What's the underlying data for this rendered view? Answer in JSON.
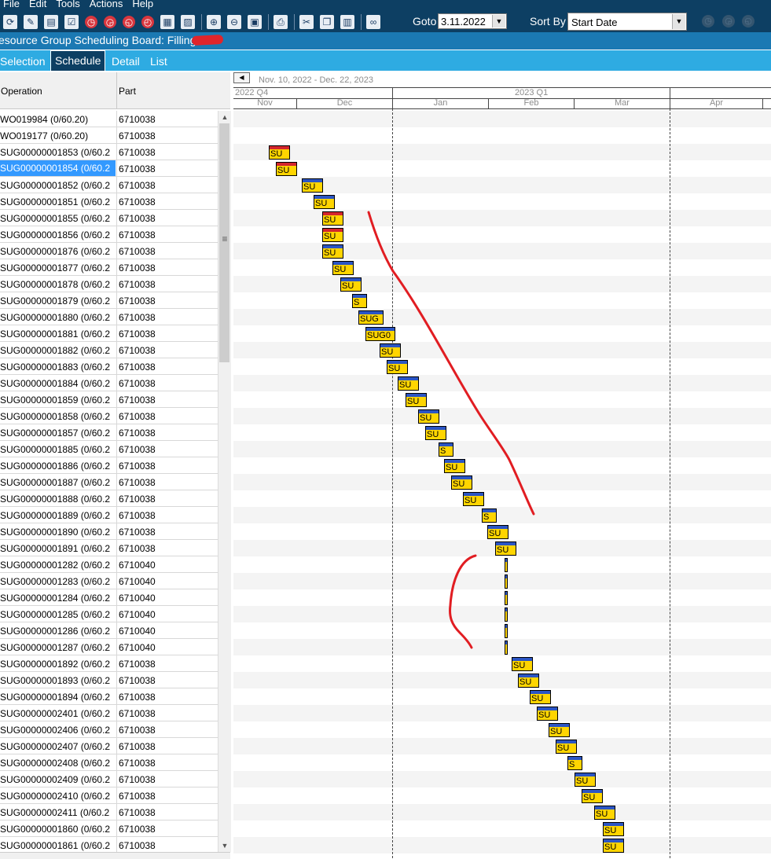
{
  "menu": [
    "File",
    "Edit",
    "Tools",
    "Actions",
    "Help"
  ],
  "toolbar": {
    "goto_label": "Goto",
    "goto_value": "3.11.2022",
    "sort_label": "Sort By",
    "sort_value": "Start Date"
  },
  "title": "esource Group Scheduling Board: Filling",
  "tabs": [
    "Selection",
    "Schedule",
    "Detail",
    "List"
  ],
  "active_tab": "Schedule",
  "columns": [
    "Operation",
    "Part"
  ],
  "rows": [
    {
      "op": "WO019984 (0/60.20)",
      "part": "6710038"
    },
    {
      "op": "WO019177 (0/60.20)",
      "part": "6710038"
    },
    {
      "op": "SUG00000001853 (0/60.2",
      "part": "6710038"
    },
    {
      "op": "SUG00000001854 (0/60.2",
      "part": "6710038",
      "selected": true
    },
    {
      "op": "SUG00000001852 (0/60.2",
      "part": "6710038"
    },
    {
      "op": "SUG00000001851 (0/60.2",
      "part": "6710038"
    },
    {
      "op": "SUG00000001855 (0/60.2",
      "part": "6710038"
    },
    {
      "op": "SUG00000001856 (0/60.2",
      "part": "6710038"
    },
    {
      "op": "SUG00000001876 (0/60.2",
      "part": "6710038"
    },
    {
      "op": "SUG00000001877 (0/60.2",
      "part": "6710038"
    },
    {
      "op": "SUG00000001878 (0/60.2",
      "part": "6710038"
    },
    {
      "op": "SUG00000001879 (0/60.2",
      "part": "6710038"
    },
    {
      "op": "SUG00000001880 (0/60.2",
      "part": "6710038"
    },
    {
      "op": "SUG00000001881 (0/60.2",
      "part": "6710038"
    },
    {
      "op": "SUG00000001882 (0/60.2",
      "part": "6710038"
    },
    {
      "op": "SUG00000001883 (0/60.2",
      "part": "6710038"
    },
    {
      "op": "SUG00000001884 (0/60.2",
      "part": "6710038"
    },
    {
      "op": "SUG00000001859 (0/60.2",
      "part": "6710038"
    },
    {
      "op": "SUG00000001858 (0/60.2",
      "part": "6710038"
    },
    {
      "op": "SUG00000001857 (0/60.2",
      "part": "6710038"
    },
    {
      "op": "SUG00000001885 (0/60.2",
      "part": "6710038"
    },
    {
      "op": "SUG00000001886 (0/60.2",
      "part": "6710038"
    },
    {
      "op": "SUG00000001887 (0/60.2",
      "part": "6710038"
    },
    {
      "op": "SUG00000001888 (0/60.2",
      "part": "6710038"
    },
    {
      "op": "SUG00000001889 (0/60.2",
      "part": "6710038"
    },
    {
      "op": "SUG00000001890 (0/60.2",
      "part": "6710038"
    },
    {
      "op": "SUG00000001891 (0/60.2",
      "part": "6710038"
    },
    {
      "op": "SUG00000001282 (0/60.2",
      "part": "6710040"
    },
    {
      "op": "SUG00000001283 (0/60.2",
      "part": "6710040"
    },
    {
      "op": "SUG00000001284 (0/60.2",
      "part": "6710040"
    },
    {
      "op": "SUG00000001285 (0/60.2",
      "part": "6710040"
    },
    {
      "op": "SUG00000001286 (0/60.2",
      "part": "6710040"
    },
    {
      "op": "SUG00000001287 (0/60.2",
      "part": "6710040"
    },
    {
      "op": "SUG00000001892 (0/60.2",
      "part": "6710038"
    },
    {
      "op": "SUG00000001893 (0/60.2",
      "part": "6710038"
    },
    {
      "op": "SUG00000001894 (0/60.2",
      "part": "6710038"
    },
    {
      "op": "SUG00000002401 (0/60.2",
      "part": "6710038"
    },
    {
      "op": "SUG00000002406 (0/60.2",
      "part": "6710038"
    },
    {
      "op": "SUG00000002407 (0/60.2",
      "part": "6710038"
    },
    {
      "op": "SUG00000002408 (0/60.2",
      "part": "6710038"
    },
    {
      "op": "SUG00000002409 (0/60.2",
      "part": "6710038"
    },
    {
      "op": "SUG00000002410 (0/60.2",
      "part": "6710038"
    },
    {
      "op": "SUG00000002411 (0/60.2",
      "part": "6710038"
    },
    {
      "op": "SUG00000001860 (0/60.2",
      "part": "6710038"
    },
    {
      "op": "SUG00000001861 (0/60.2",
      "part": "6710038"
    }
  ],
  "gantt": {
    "range_label": "Nov. 10, 2022 - Dec. 22, 2023",
    "quarters": [
      "2022 Q4",
      "2023 Q1"
    ],
    "months": [
      "Nov",
      "Dec",
      "Jan",
      "Feb",
      "Mar",
      "Apr"
    ],
    "bar_labels": [
      "",
      "",
      "SU",
      "SU",
      "SU",
      "SU",
      "SU",
      "SU",
      "SU",
      "SU",
      "SU",
      "S",
      "SUG",
      "SUG0",
      "SU",
      "SU",
      "SU",
      "SU",
      "SU",
      "SU",
      "S",
      "SU",
      "SU",
      "SU",
      "S",
      "SU",
      "SU",
      "",
      "",
      "",
      "",
      "",
      "",
      "SU",
      "SU",
      "SU",
      "SU",
      "SU",
      "SU",
      "S",
      "SU",
      "SU",
      "SU",
      "SU",
      "SU"
    ]
  },
  "colors": {
    "bar_fill": "#ffd500",
    "bar_cap_blue": "#2b55c4",
    "bar_cap_red": "#d3262e",
    "header_dark": "#0d3f63",
    "title_blue": "#1b79b3",
    "tab_blue": "#2eabe2",
    "selected_row": "#3399ff"
  }
}
